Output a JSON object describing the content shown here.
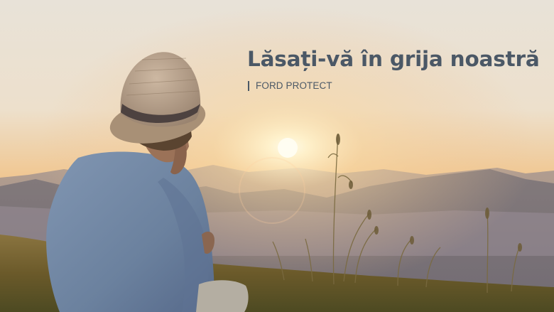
{
  "banner": {
    "headline": "Lăsați-vă în grija noastră",
    "subline": "FORD PROTECT",
    "text_color": "#4b5866"
  },
  "colors": {
    "sky_top": "#e7e1d6",
    "sky_horizon": "#f2c48c",
    "sun": "#fff6dc",
    "mountains": "#6e6a6e",
    "grass": "#6a5a2c",
    "shirt": "#6e86a6",
    "hat": "#b49a80"
  }
}
